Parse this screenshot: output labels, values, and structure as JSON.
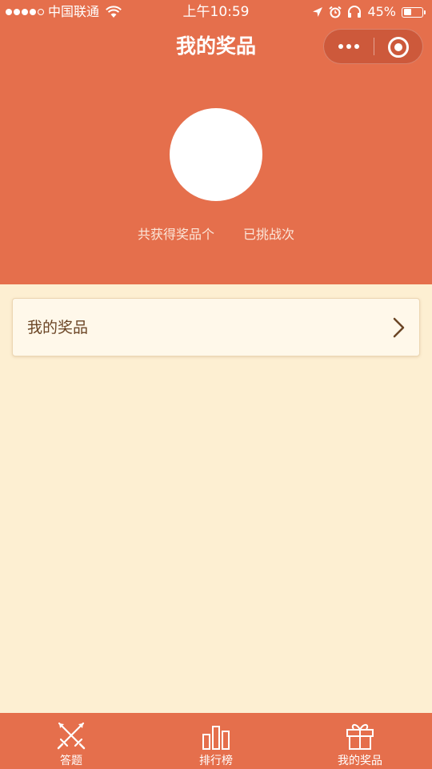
{
  "status_bar": {
    "carrier": "中国联通",
    "time": "上午10:59",
    "battery": "45%",
    "battery_level": 0.45
  },
  "nav": {
    "title": "我的奖品"
  },
  "profile": {
    "prizes_text": "共获得奖品个",
    "challenges_text": "已挑战次"
  },
  "list": {
    "items": [
      {
        "label": "我的奖品"
      }
    ]
  },
  "tabbar": {
    "tabs": [
      {
        "label": "答题",
        "icon": "crossed-swords-icon"
      },
      {
        "label": "排行榜",
        "icon": "bar-chart-icon"
      },
      {
        "label": "我的奖品",
        "icon": "gift-icon"
      }
    ],
    "active_index": 2
  },
  "colors": {
    "header": "#e56f4c",
    "page_background": "#fdefd2",
    "card_background": "#fff8ea",
    "card_text": "#6b4525"
  }
}
